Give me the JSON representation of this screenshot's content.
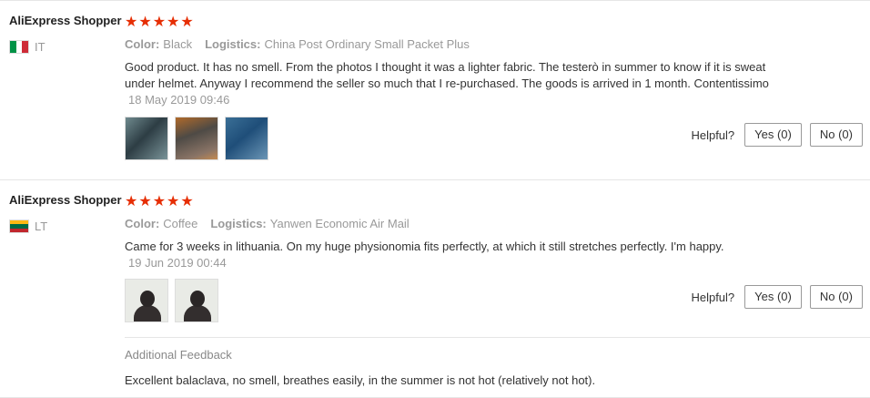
{
  "reviews": [
    {
      "user": "AliExpress Shopper",
      "country_code": "IT",
      "stars": "★★★★★",
      "rating": 5,
      "color_label": "Color:",
      "color_value": "Black",
      "logistics_label": "Logistics:",
      "logistics_value": "China Post Ordinary Small Packet Plus",
      "text": "Good product. It has no smell. From the photos I thought it was a lighter fabric. The testerò in summer to know if it is sweat under helmet. Anyway I recommend the seller so much that I re-purchased. The goods is arrived in 1 month. Contentissimo",
      "date": "18 May 2019 09:46",
      "helpful_label": "Helpful?",
      "yes_label": "Yes (0)",
      "no_label": "No (0)"
    },
    {
      "user": "AliExpress Shopper",
      "country_code": "LT",
      "stars": "★★★★★",
      "rating": 5,
      "color_label": "Color:",
      "color_value": "Coffee",
      "logistics_label": "Logistics:",
      "logistics_value": "Yanwen Economic Air Mail",
      "text": "Came for 3 weeks in lithuania. On my huge physionomia fits perfectly, at which it still stretches perfectly. I'm happy.",
      "date": "19 Jun 2019 00:44",
      "helpful_label": "Helpful?",
      "yes_label": "Yes (0)",
      "no_label": "No (0)",
      "additional_title": "Additional Feedback",
      "additional_text": "Excellent balaclava, no smell, breathes easily, in the summer is not hot (relatively not hot)."
    }
  ],
  "colors": {
    "star": "#e62e04",
    "muted": "#999999",
    "text": "#333333"
  }
}
